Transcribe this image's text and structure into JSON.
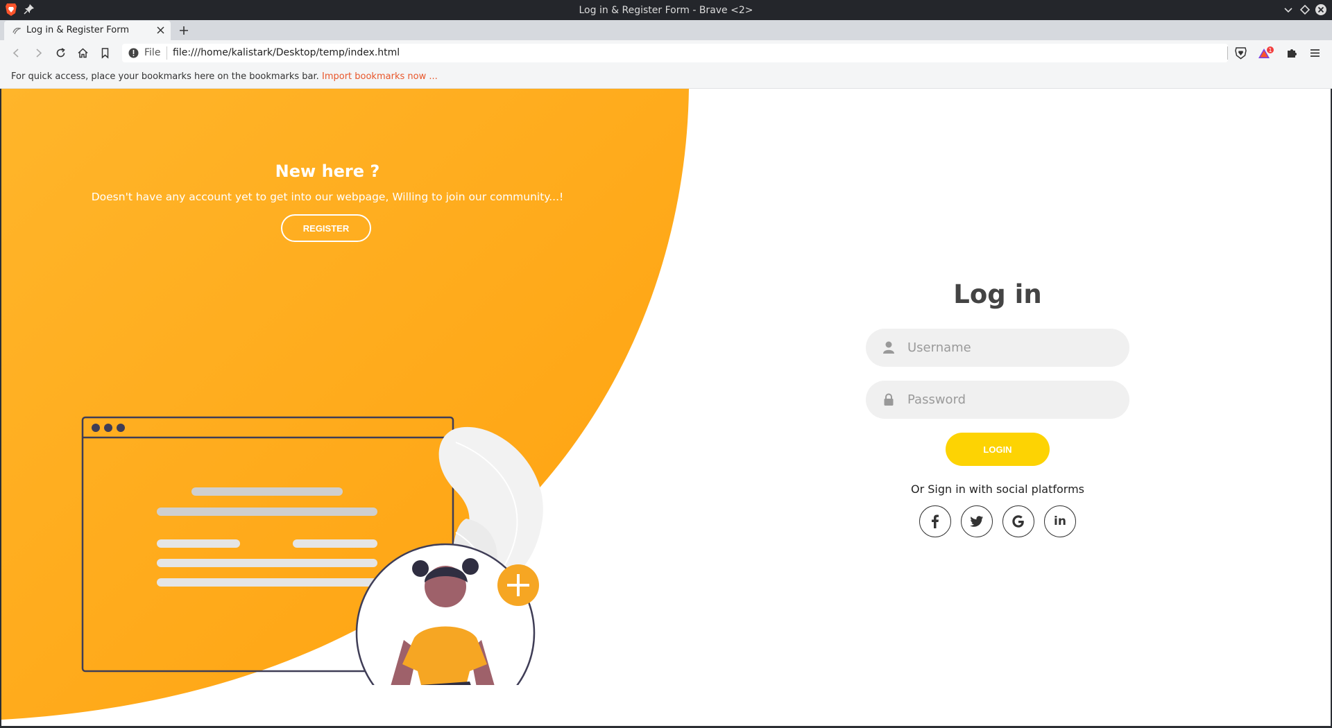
{
  "window": {
    "title": "Log in & Register Form - Brave <2>"
  },
  "tab": {
    "label": "Log in & Register Form"
  },
  "address": {
    "scheme": "File",
    "url": "file:///home/kalistark/Desktop/temp/index.html"
  },
  "bookmarks": {
    "text": "For quick access, place your bookmarks here on the bookmarks bar.",
    "link": "Import bookmarks now ..."
  },
  "left_panel": {
    "title": "New here ?",
    "description": "Doesn't have any account yet to get into our webpage, Willing to join our community...!",
    "register_label": "REGISTER"
  },
  "login": {
    "title": "Log in",
    "username_placeholder": "Username",
    "password_placeholder": "Password",
    "button_label": "LOGIN",
    "social_text": "Or Sign in with social platforms",
    "social": [
      "facebook",
      "twitter",
      "google",
      "linkedin"
    ],
    "linkedin_text": "in"
  },
  "colors": {
    "accent": "#ffaa10",
    "button": "#fdd303",
    "text_dark": "#444444"
  }
}
